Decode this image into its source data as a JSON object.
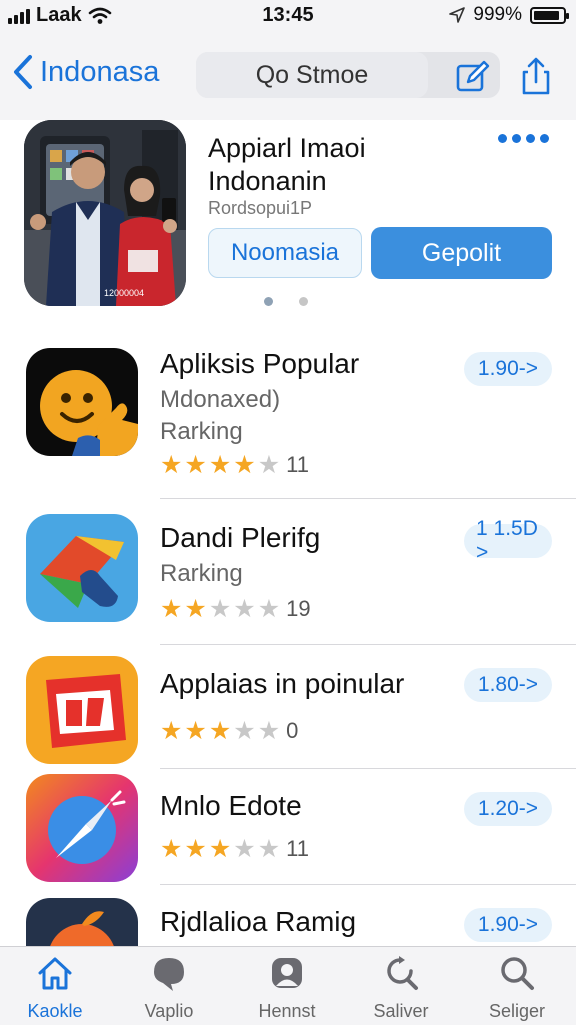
{
  "status_bar": {
    "carrier": "Laak",
    "time": "13:45",
    "battery_text": "999%",
    "battery_level": 0.9
  },
  "nav": {
    "back_label": "Indonasa",
    "search_text": "Qo Stmoe",
    "icons": [
      "edit-icon",
      "share-icon"
    ]
  },
  "featured": {
    "title_line1": "Appiarl Imaoi",
    "title_line2": "Indonanin",
    "subtitle": "Rordsopui1P",
    "photo_caption": "12000004",
    "button_secondary": "Noomasia",
    "button_primary": "Gepolit",
    "page_indicator": {
      "pages": 2,
      "current": 1
    }
  },
  "apps": [
    {
      "name": "Apliksis Popular",
      "line2": "Mdonaxed)",
      "line3": "Rarking",
      "stars": 4,
      "rating_count": "11",
      "price": "1.90->"
    },
    {
      "name": "Dandi Plerifg",
      "line2": "Rarking",
      "stars": 2,
      "rating_count": "19",
      "price": "1 1.5D >"
    },
    {
      "name": "Applaias in poinular",
      "stars": 3,
      "rating_count": "0",
      "price": "1.80->"
    },
    {
      "name": "Mnlo Edote",
      "stars": 3,
      "rating_count": "11",
      "price": "1.20->"
    },
    {
      "name": "Rjdlalioa Ramig",
      "price": "1.90->"
    }
  ],
  "tabs": [
    {
      "label": "Kaokle",
      "icon": "home-icon",
      "active": true
    },
    {
      "label": "Vaplio",
      "icon": "chat-icon",
      "active": false
    },
    {
      "label": "Hennst",
      "icon": "profile-icon",
      "active": false
    },
    {
      "label": "Saliver",
      "icon": "refresh-search-icon",
      "active": false
    },
    {
      "label": "Seliger",
      "icon": "search-icon",
      "active": false
    }
  ],
  "colors": {
    "accent": "#1a73d9",
    "star": "#f5a623",
    "button_fill": "#3b8fde",
    "bar_bg": "#f4f4f6"
  }
}
